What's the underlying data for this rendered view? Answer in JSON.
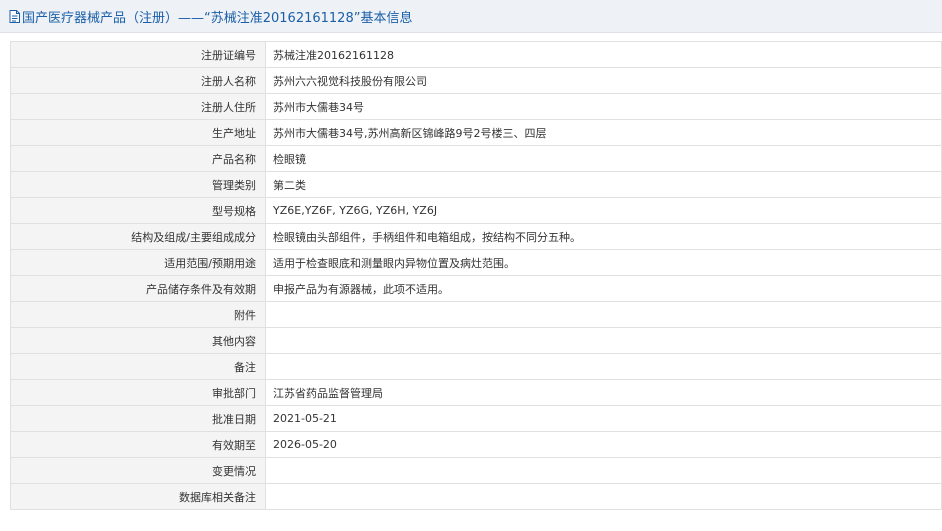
{
  "header": {
    "title": "国产医疗器械产品（注册）——“苏械注准20162161128”基本信息"
  },
  "rows": [
    {
      "label": "注册证编号",
      "value": "苏械注准20162161128"
    },
    {
      "label": "注册人名称",
      "value": "苏州六六视觉科技股份有限公司"
    },
    {
      "label": "注册人住所",
      "value": "苏州市大儒巷34号"
    },
    {
      "label": "生产地址",
      "value": "苏州市大儒巷34号,苏州高新区锦峰路9号2号楼三、四层"
    },
    {
      "label": "产品名称",
      "value": "检眼镜"
    },
    {
      "label": "管理类别",
      "value": "第二类"
    },
    {
      "label": "型号规格",
      "value": "YZ6E,YZ6F, YZ6G, YZ6H, YZ6J"
    },
    {
      "label": "结构及组成/主要组成成分",
      "value": "检眼镜由头部组件，手柄组件和电箱组成，按结构不同分五种。"
    },
    {
      "label": "适用范围/预期用途",
      "value": "适用于检查眼底和测量眼内异物位置及病灶范围。"
    },
    {
      "label": "产品储存条件及有效期",
      "value": "申报产品为有源器械，此项不适用。"
    },
    {
      "label": "附件",
      "value": ""
    },
    {
      "label": "其他内容",
      "value": ""
    },
    {
      "label": "备注",
      "value": ""
    },
    {
      "label": "审批部门",
      "value": "江苏省药品监督管理局"
    },
    {
      "label": "批准日期",
      "value": "2021-05-21"
    },
    {
      "label": "有效期至",
      "value": "2026-05-20"
    },
    {
      "label": "变更情况",
      "value": ""
    },
    {
      "label": "数据库相关备注",
      "value": ""
    }
  ]
}
